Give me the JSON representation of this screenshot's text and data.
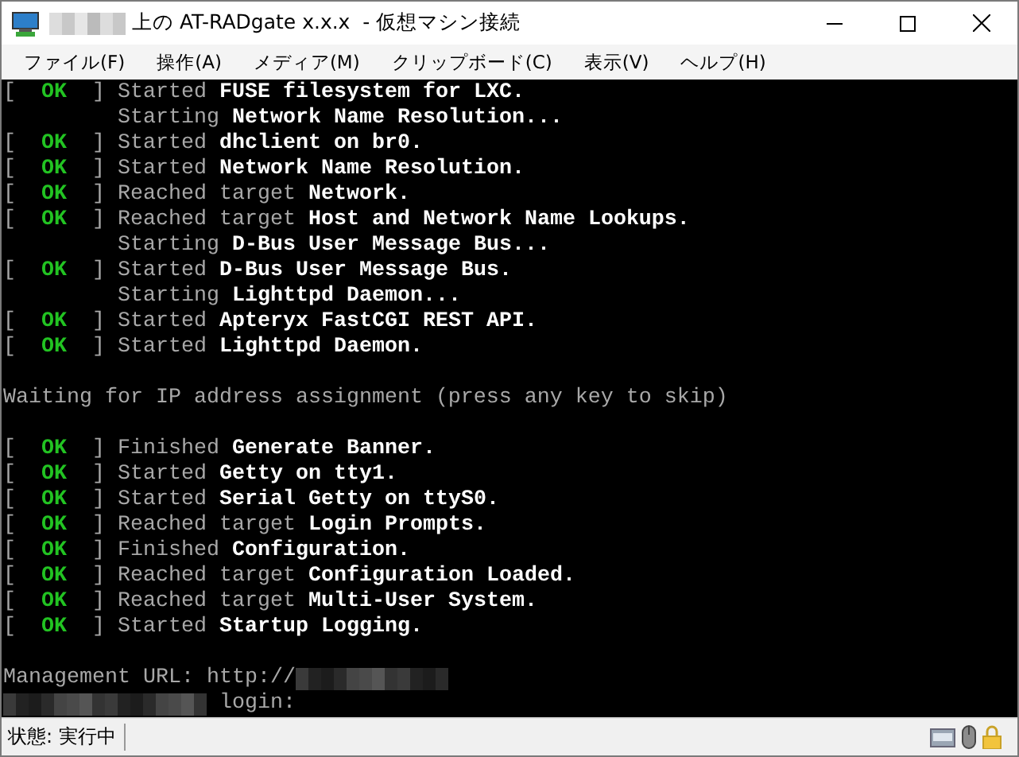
{
  "window": {
    "title": "上の AT-RADgate x.x.x  - 仮想マシン接続",
    "title_redacted": true
  },
  "menu": [
    "ファイル(F)",
    "操作(A)",
    "メディア(M)",
    "クリップボード(C)",
    "表示(V)",
    "ヘルプ(H)"
  ],
  "console": [
    {
      "kind": "ok",
      "open": "[",
      "status": "OK",
      "close": "]",
      "verb": "Started",
      "target": "FUSE filesystem for LXC."
    },
    {
      "kind": "starting",
      "verb": "Starting",
      "target": "Network Name Resolution..."
    },
    {
      "kind": "ok",
      "open": "[",
      "status": "OK",
      "close": "]",
      "verb": "Started",
      "target": "dhclient on br0."
    },
    {
      "kind": "ok",
      "open": "[",
      "status": "OK",
      "close": "]",
      "verb": "Started",
      "target": "Network Name Resolution."
    },
    {
      "kind": "ok",
      "open": "[",
      "status": "OK",
      "close": "]",
      "verb": "Reached target",
      "target": "Network."
    },
    {
      "kind": "ok",
      "open": "[",
      "status": "OK",
      "close": "]",
      "verb": "Reached target",
      "target": "Host and Network Name Lookups."
    },
    {
      "kind": "starting",
      "verb": "Starting",
      "target": "D-Bus User Message Bus..."
    },
    {
      "kind": "ok",
      "open": "[",
      "status": "OK",
      "close": "]",
      "verb": "Started",
      "target": "D-Bus User Message Bus."
    },
    {
      "kind": "starting",
      "verb": "Starting",
      "target": "Lighttpd Daemon..."
    },
    {
      "kind": "ok",
      "open": "[",
      "status": "OK",
      "close": "]",
      "verb": "Started",
      "target": "Apteryx FastCGI REST API."
    },
    {
      "kind": "ok",
      "open": "[",
      "status": "OK",
      "close": "]",
      "verb": "Started",
      "target": "Lighttpd Daemon."
    },
    {
      "kind": "blank"
    },
    {
      "kind": "plain",
      "text": "Waiting for IP address assignment (press any key to skip)"
    },
    {
      "kind": "blank"
    },
    {
      "kind": "ok",
      "open": "[",
      "status": "OK",
      "close": "]",
      "verb": "Finished",
      "target": "Generate Banner."
    },
    {
      "kind": "ok",
      "open": "[",
      "status": "OK",
      "close": "]",
      "verb": "Started",
      "target": "Getty on tty1."
    },
    {
      "kind": "ok",
      "open": "[",
      "status": "OK",
      "close": "]",
      "verb": "Started",
      "target": "Serial Getty on ttyS0."
    },
    {
      "kind": "ok",
      "open": "[",
      "status": "OK",
      "close": "]",
      "verb": "Reached target",
      "target": "Login Prompts."
    },
    {
      "kind": "ok",
      "open": "[",
      "status": "OK",
      "close": "]",
      "verb": "Finished",
      "target": "Configuration."
    },
    {
      "kind": "ok",
      "open": "[",
      "status": "OK",
      "close": "]",
      "verb": "Reached target",
      "target": "Configuration Loaded."
    },
    {
      "kind": "ok",
      "open": "[",
      "status": "OK",
      "close": "]",
      "verb": "Reached target",
      "target": "Multi-User System."
    },
    {
      "kind": "ok",
      "open": "[",
      "status": "OK",
      "close": "]",
      "verb": "Started",
      "target": "Startup Logging."
    },
    {
      "kind": "blank"
    },
    {
      "kind": "redacted_after",
      "text": "Management URL: http://"
    },
    {
      "kind": "redacted_before",
      "text": " login:"
    }
  ],
  "status_bar": {
    "state": "状態: 実行中"
  }
}
